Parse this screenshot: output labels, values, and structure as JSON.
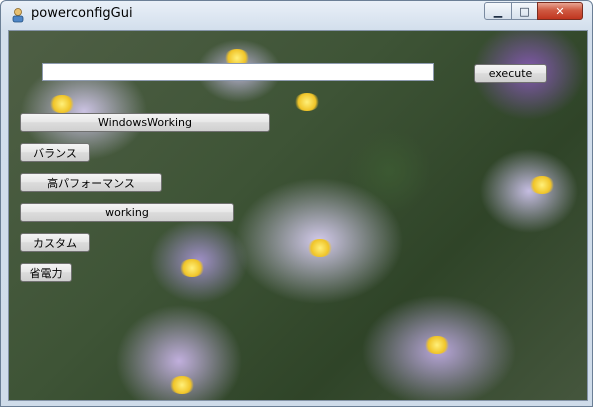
{
  "window": {
    "title": "powerconfigGui"
  },
  "title_buttons": {
    "minimize": "▁",
    "maximize": "□",
    "close": "✕"
  },
  "command_input": {
    "value": "",
    "placeholder": ""
  },
  "buttons": {
    "execute": "execute",
    "windows_working": "WindowsWorking",
    "balance": "バランス",
    "high_performance": "高パフォーマンス",
    "working": "working",
    "custom": "カスタム",
    "power_saver": "省電力"
  }
}
